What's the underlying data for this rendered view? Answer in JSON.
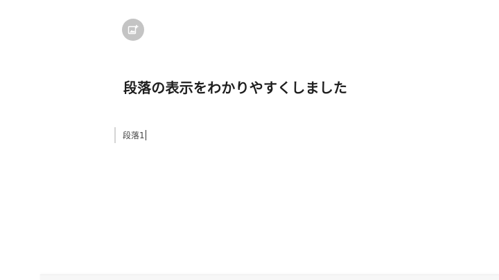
{
  "editor": {
    "title": "段落の表示をわかりやすくしました",
    "paragraph": "段落1"
  },
  "icons": {
    "add_image": "add-image-icon"
  },
  "colors": {
    "icon_bg": "#c4c4c4",
    "title_text": "#1e1e1e",
    "paragraph_text": "#444444",
    "block_indicator": "#d4d4d4"
  }
}
